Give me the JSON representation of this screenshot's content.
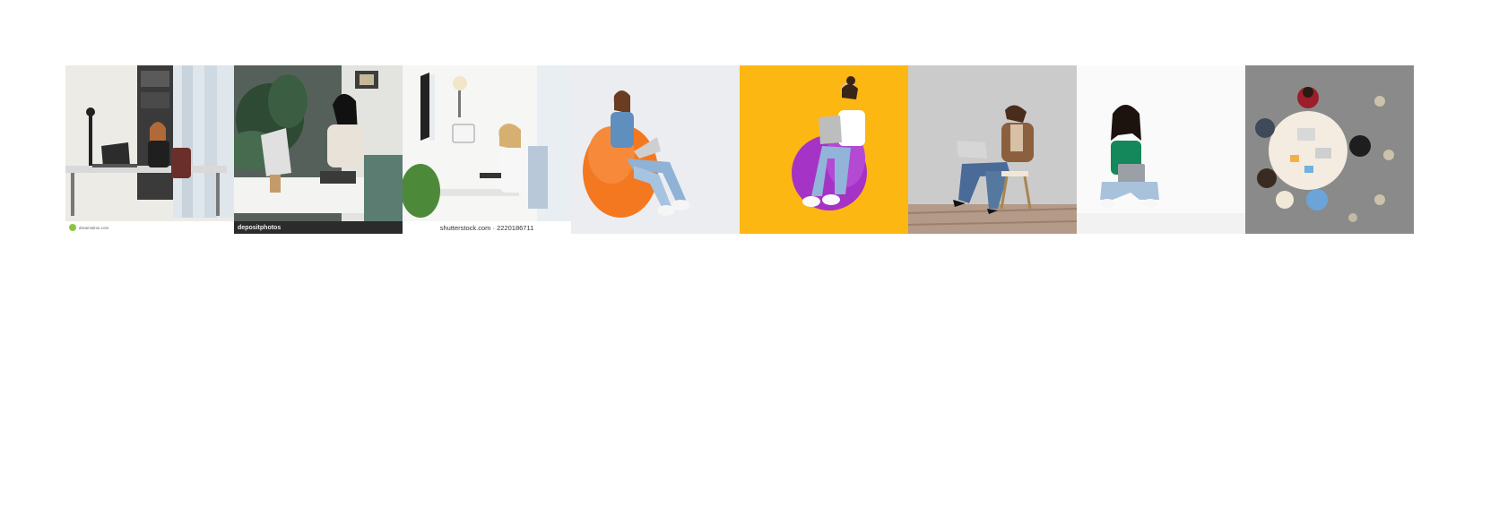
{
  "tiles": [
    {
      "id": 1,
      "subject": "woman at desk with laptop in office",
      "background": "#f2f2ef",
      "watermark": {
        "brand": "Dreamstime",
        "text": "dreamstime.com"
      }
    },
    {
      "id": 2,
      "subject": "woman with glasses typing on laptop, plants",
      "background": "#5f6b63",
      "watermark": {
        "brand": "depositphotos",
        "text": "depositphotos"
      }
    },
    {
      "id": 3,
      "subject": "woman at desk with monitor and laptop",
      "background": "#f4f4f2",
      "watermark": {
        "brand": "shutterstock",
        "text": "shutterstock.com · 2220186711"
      }
    },
    {
      "id": 4,
      "subject": "woman on orange bean bag with laptop",
      "background": "#eeeef2",
      "accent": "#f5781e"
    },
    {
      "id": 5,
      "subject": "woman on purple bean bag with laptop",
      "background": "#fdb814",
      "accent": "#a535c4"
    },
    {
      "id": 6,
      "subject": "woman on chair with laptop, grey wall",
      "background": "#c9c9c9",
      "accent": "#9a6b4a"
    },
    {
      "id": 7,
      "subject": "woman in green top sitting with laptop",
      "background": "#fafafa",
      "accent": "#1a8a5a"
    },
    {
      "id": 8,
      "subject": "top view of team meeting at round table",
      "background": "#8d8d8d",
      "accent": "#f2e6d8"
    }
  ]
}
